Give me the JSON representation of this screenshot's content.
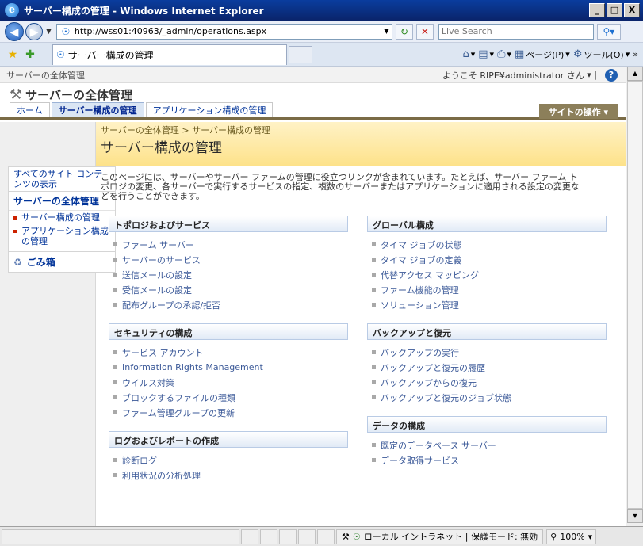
{
  "window": {
    "title": "サーバー構成の管理 - Windows Internet Explorer",
    "ie_logo": "e",
    "minimize": "_",
    "maximize": "□",
    "close": "X"
  },
  "address": {
    "url": "http://wss01:40963/_admin/operations.aspx",
    "search_placeholder": "Live Search"
  },
  "tab": {
    "label": "サーバー構成の管理"
  },
  "commands": {
    "page": "ページ(P)",
    "tools": "ツール(O)"
  },
  "sp": {
    "global_site": "サーバーの全体管理",
    "welcome": "ようこそ RIPE¥administrator さん",
    "help": "?",
    "site_title": "サーバーの全体管理",
    "nav": [
      {
        "label": "ホーム"
      },
      {
        "label": "サーバー構成の管理"
      },
      {
        "label": "アプリケーション構成の管理"
      }
    ],
    "site_actions": "サイトの操作",
    "breadcrumb": "サーバーの全体管理 > サーバー構成の管理",
    "page_title": "サーバー構成の管理",
    "description": "このページには、サーバーやサーバー ファームの管理に役立つリンクが含まれています。たとえば、サーバー ファーム トポロジの変更、各サーバーで実行するサービスの指定、複数のサーバーまたはアプリケーションに適用される設定の変更などを行うことができます。"
  },
  "quicklaunch": {
    "view_all": "すべてのサイト コンテンツの表示",
    "heading": "サーバーの全体管理",
    "items": [
      {
        "label": "サーバー構成の管理"
      },
      {
        "label": "アプリケーション構成の管理"
      }
    ],
    "recycle": "ごみ箱"
  },
  "sections": {
    "left": [
      {
        "title": "トポロジおよびサービス",
        "links": [
          "ファーム サーバー",
          "サーバーのサービス",
          "送信メールの設定",
          "受信メールの設定",
          "配布グループの承認/拒否"
        ]
      },
      {
        "title": "セキュリティの構成",
        "links": [
          "サービス アカウント",
          "Information Rights Management",
          "ウイルス対策",
          "ブロックするファイルの種類",
          "ファーム管理グループの更新"
        ]
      },
      {
        "title": "ログおよびレポートの作成",
        "links": [
          "診断ログ",
          "利用状況の分析処理"
        ]
      }
    ],
    "right": [
      {
        "title": "グローバル構成",
        "links": [
          "タイマ ジョブの状態",
          "タイマ ジョブの定義",
          "代替アクセス マッピング",
          "ファーム機能の管理",
          "ソリューション管理"
        ]
      },
      {
        "title": "バックアップと復元",
        "links": [
          "バックアップの実行",
          "バックアップと復元の履歴",
          "バックアップからの復元",
          "バックアップと復元のジョブ状態"
        ]
      },
      {
        "title": "データの構成",
        "links": [
          "既定のデータベース サーバー",
          "データ取得サービス"
        ]
      }
    ]
  },
  "status": {
    "zone": "ローカル イントラネット | 保護モード: 無効",
    "zoom": "100%"
  }
}
